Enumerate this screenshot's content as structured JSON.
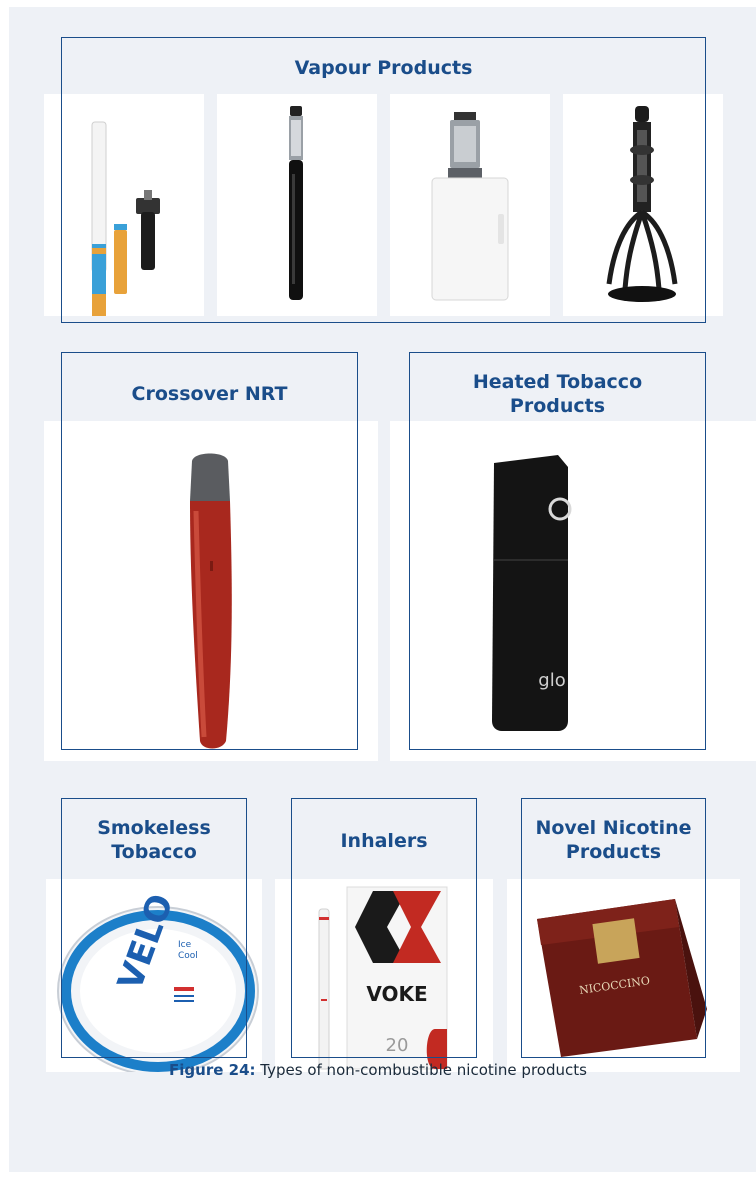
{
  "sections": {
    "vapour": {
      "title": "Vapour Products"
    },
    "crossover": {
      "title": "Crossover NRT"
    },
    "heated": {
      "title_line1": "Heated Tobacco",
      "title_line2": "Products",
      "device_brand": "glo"
    },
    "smokeless": {
      "title_line1": "Smokeless",
      "title_line2": "Tobacco",
      "tin_brand": "VELO",
      "tin_flavour_1": "Ice",
      "tin_flavour_2": "Cool"
    },
    "inhalers": {
      "title": "Inhalers",
      "box_brand": "VOKE",
      "box_count": "20"
    },
    "novel": {
      "title_line1": "Novel Nicotine",
      "title_line2": "Products",
      "pouch_brand": "NICOCCINO"
    }
  },
  "caption": {
    "label": "Figure 24:",
    "text": " Types of non-combustible nicotine products"
  },
  "colors": {
    "frame": "#1a4d8a",
    "panel": "#eef1f6",
    "heading": "#1a4d8a"
  }
}
